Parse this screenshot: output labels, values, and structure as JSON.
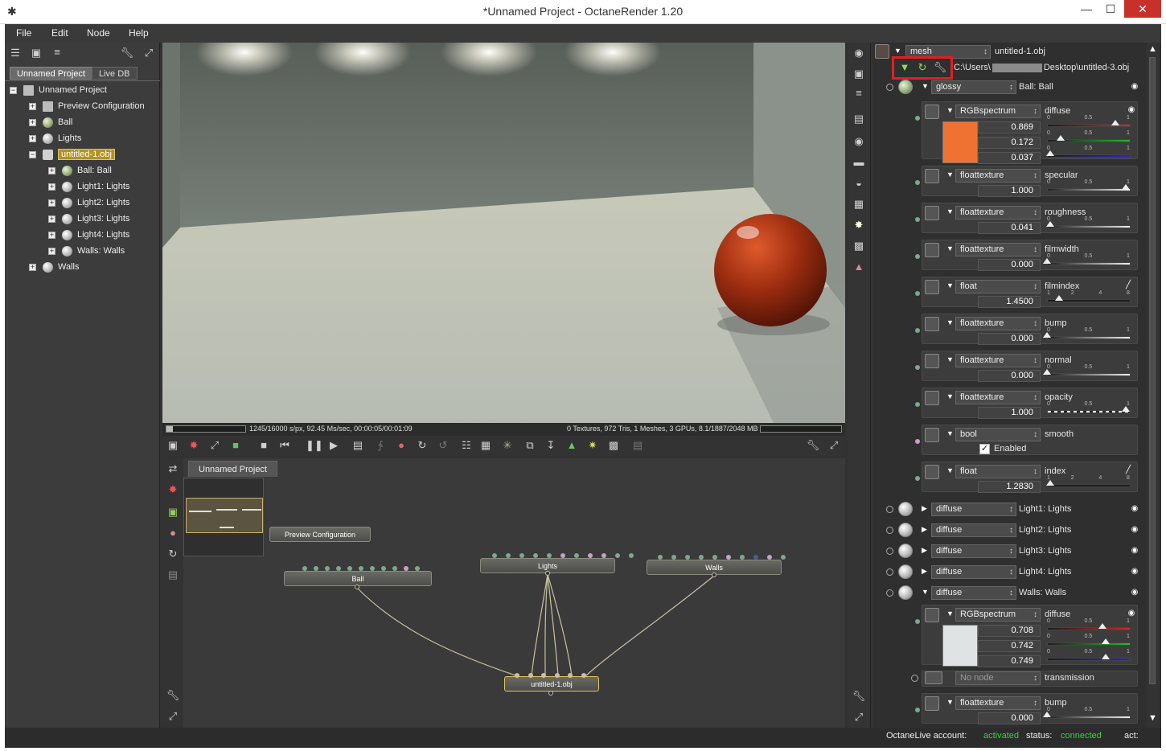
{
  "window": {
    "title": "*Unnamed Project - OctaneRender 1.20",
    "minimize": "—",
    "maximize": "☐",
    "close": "✕",
    "app_icon": "✱"
  },
  "menu": [
    "File",
    "Edit",
    "Node",
    "Help"
  ],
  "outliner": {
    "tabs": [
      "Unnamed Project",
      "Live DB"
    ],
    "items": [
      {
        "label": "Unnamed Project",
        "depth": 0,
        "expander": "−"
      },
      {
        "label": "Preview Configuration",
        "depth": 1,
        "expander": "+"
      },
      {
        "label": "Ball",
        "depth": 1,
        "expander": "+"
      },
      {
        "label": "Lights",
        "depth": 1,
        "expander": "+"
      },
      {
        "label": "untitled-1.obj",
        "depth": 1,
        "expander": "−"
      },
      {
        "label": "Ball: Ball",
        "depth": 2,
        "expander": "+"
      },
      {
        "label": "Light1: Lights",
        "depth": 2,
        "expander": "+"
      },
      {
        "label": "Light2: Lights",
        "depth": 2,
        "expander": "+"
      },
      {
        "label": "Light3: Lights",
        "depth": 2,
        "expander": "+"
      },
      {
        "label": "Light4: Lights",
        "depth": 2,
        "expander": "+"
      },
      {
        "label": "Walls: Walls",
        "depth": 2,
        "expander": "+"
      },
      {
        "label": "Walls",
        "depth": 1,
        "expander": "+"
      }
    ]
  },
  "render_status": {
    "left": "1245/16000 s/px, 92.45 Ms/sec, 00:00:05/00:01:09",
    "right": "0 Textures, 972 Tris, 1 Meshes, 3 GPUs, 8.1/1887/2048 MB"
  },
  "graph": {
    "tab": "Unnamed Project",
    "nodes": {
      "preview": "Preview Configuration",
      "ball": "Ball",
      "lights": "Lights",
      "walls": "Walls",
      "mesh": "untitled-1.obj"
    }
  },
  "inspector": {
    "mesh_type": "mesh",
    "mesh_name": "untitled-1.obj",
    "path": "C:\\Users\\",
    "path_end": "Desktop\\untitled-3.obj",
    "material": {
      "type": "glossy",
      "name": "Ball: Ball"
    },
    "params": [
      {
        "type": "RGBspectrum",
        "name": "diffuse",
        "values": [
          "0.869",
          "0.172",
          "0.037"
        ],
        "swatch": "#ef7233",
        "levels": [
          0.869,
          0.172,
          0.037
        ]
      },
      {
        "type": "floattexture",
        "name": "specular",
        "value": "1.000",
        "level": 1.0
      },
      {
        "type": "floattexture",
        "name": "roughness",
        "value": "0.041",
        "level": 0.041
      },
      {
        "type": "floattexture",
        "name": "filmwidth",
        "value": "0.000",
        "level": 0.0
      },
      {
        "type": "float",
        "name": "filmindex",
        "value": "1.4500",
        "level": 0.15
      },
      {
        "type": "floattexture",
        "name": "bump",
        "value": "0.000",
        "level": 0.0
      },
      {
        "type": "floattexture",
        "name": "normal",
        "value": "0.000",
        "level": 0.0
      },
      {
        "type": "floattexture",
        "name": "opacity",
        "value": "1.000",
        "level": 1.0
      },
      {
        "type": "bool",
        "name": "smooth",
        "checkbox": "Enabled"
      },
      {
        "type": "float",
        "name": "index",
        "value": "1.2830",
        "level": 0.04
      }
    ],
    "collapsed": [
      {
        "type": "diffuse",
        "name": "Light1: Lights"
      },
      {
        "type": "diffuse",
        "name": "Light2: Lights"
      },
      {
        "type": "diffuse",
        "name": "Light3: Lights"
      },
      {
        "type": "diffuse",
        "name": "Light4: Lights"
      }
    ],
    "walls": {
      "type": "diffuse",
      "name": "Walls: Walls",
      "diffuse": {
        "type": "RGBspectrum",
        "name": "diffuse",
        "values": [
          "0.708",
          "0.742",
          "0.749"
        ],
        "swatch": "#e0e3e4",
        "levels": [
          0.708,
          0.742,
          0.749
        ]
      },
      "transmission": {
        "type": "No node",
        "name": "transmission"
      },
      "bump": {
        "type": "floattexture",
        "name": "bump",
        "value": "0.000"
      }
    }
  },
  "slider_labels": {
    "zero": "0",
    "half": "0.5",
    "one": "1",
    "t1": "1",
    "t2": "2",
    "t4": "4",
    "t8": "8"
  },
  "status": {
    "account_label": "OctaneLive account:",
    "account_value": "activated",
    "status_label": "status:",
    "status_value": "connected",
    "act_label": "act:"
  },
  "colors": {
    "accent_select": "#b3921e",
    "highlight_red": "#e02020",
    "status_green": "#3bd13b"
  }
}
